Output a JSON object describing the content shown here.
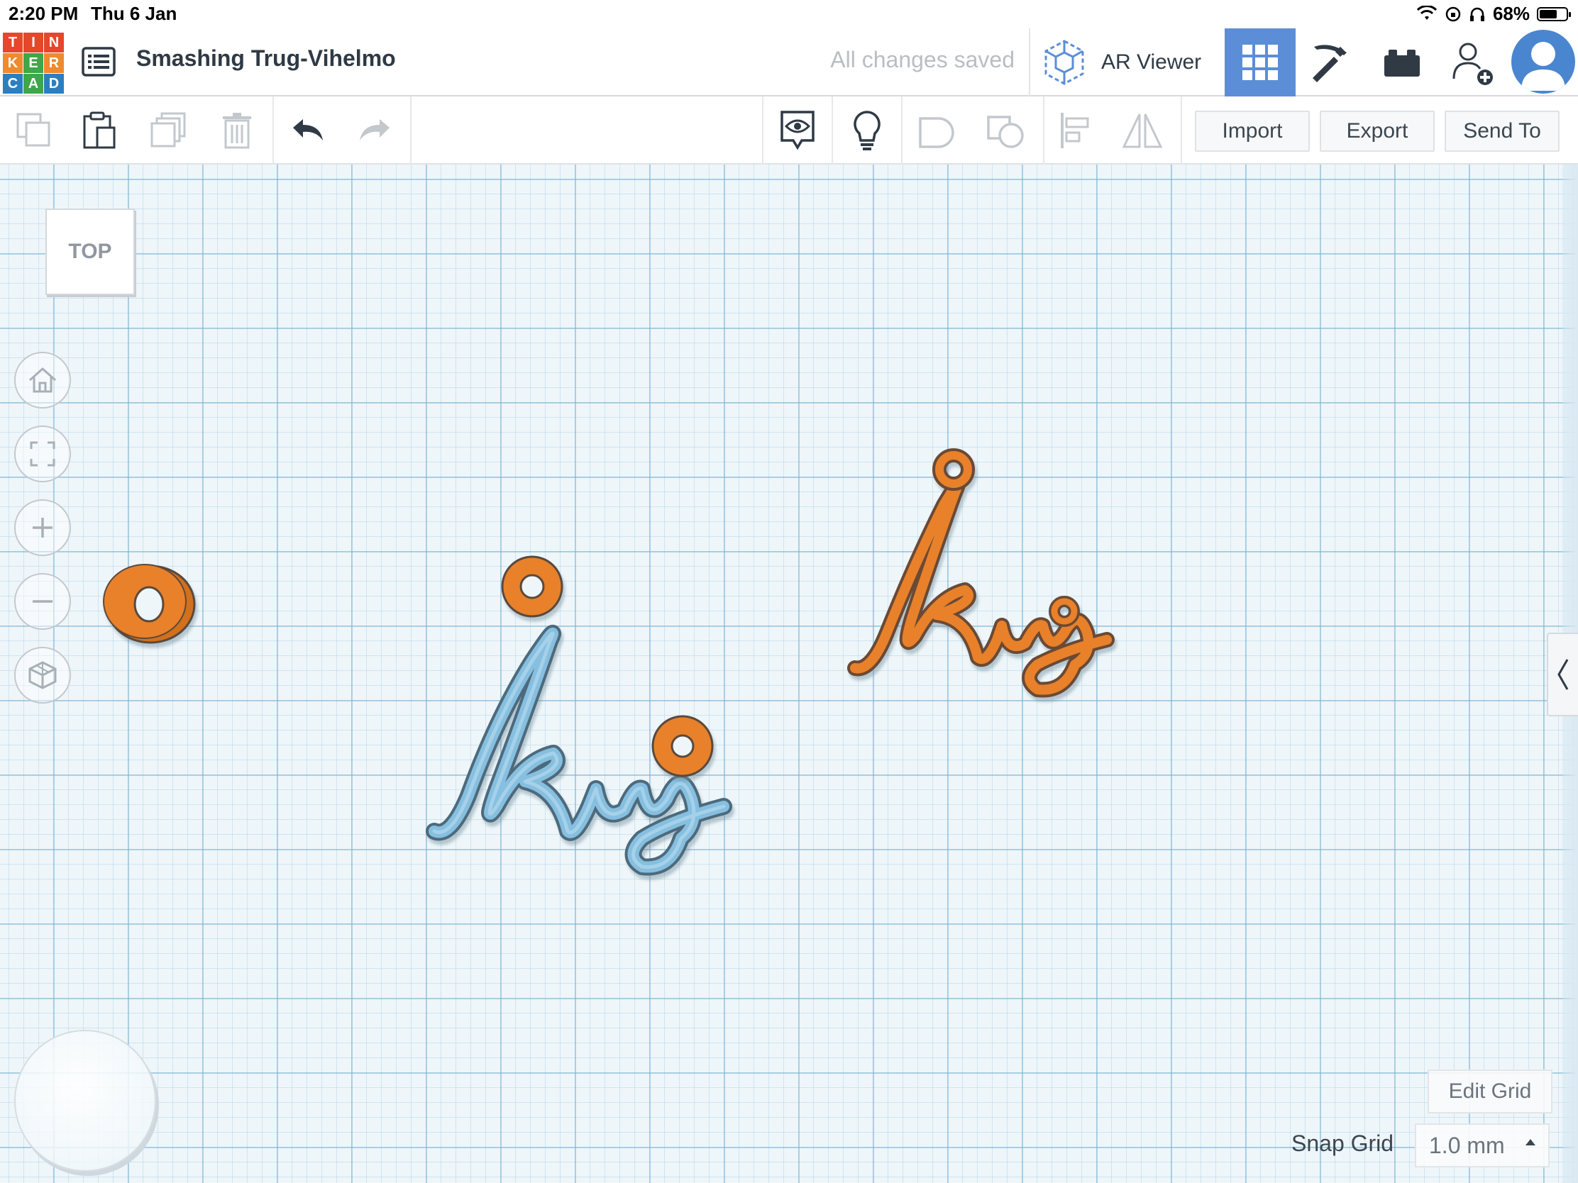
{
  "status_bar": {
    "time": "2:20 PM",
    "date": "Thu 6 Jan",
    "battery": "68%",
    "battery_level": 0.68
  },
  "header": {
    "logo_letters": [
      "T",
      "I",
      "N",
      "K",
      "E",
      "R",
      "C",
      "A",
      "D"
    ],
    "logo_colors": [
      "#e5472a",
      "#e5472a",
      "#e5472a",
      "#ef8a2e",
      "#3fa64a",
      "#ef8a2e",
      "#2b7fc1",
      "#3fa64a",
      "#2b7fc1"
    ],
    "design_title": "Smashing Trug-Vihelmo",
    "save_status": "All changes saved",
    "ar_viewer_label": "AR Viewer",
    "accent": "#5b8ed6"
  },
  "toolbar": {
    "import_label": "Import",
    "export_label": "Export",
    "send_to_label": "Send To"
  },
  "workplane": {
    "view_cube_label": "TOP",
    "edit_grid_label": "Edit Grid",
    "snap_grid_label": "Snap Grid",
    "snap_grid_value": "1.0 mm",
    "grid_color": "#7db4d2",
    "shape_colors": {
      "orange": "#e8812b",
      "blue": "#86bfe0"
    },
    "shape_text": "King"
  }
}
